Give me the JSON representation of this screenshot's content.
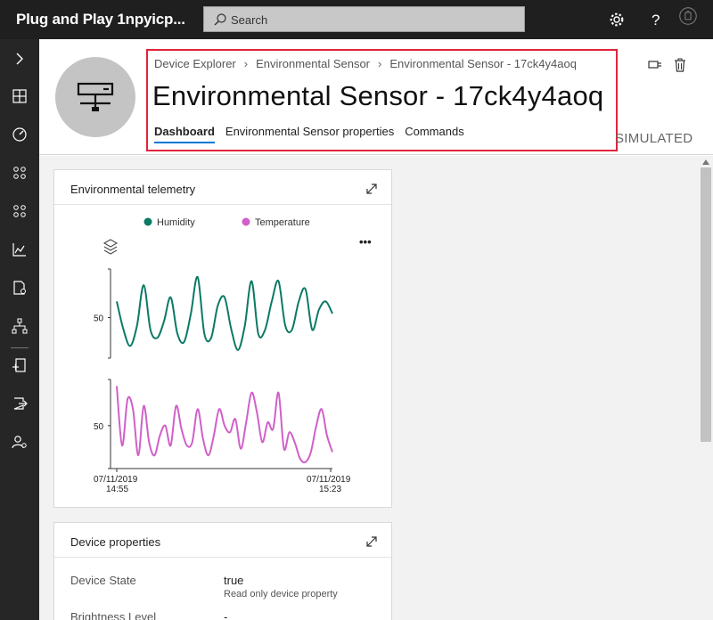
{
  "app": {
    "title": "Plug and Play 1npyicp..."
  },
  "search": {
    "placeholder": "Search"
  },
  "topbar": {
    "settings_icon": "gear-icon",
    "help_icon": "question-icon",
    "account_icon": "account-icon"
  },
  "nav": {
    "items": [
      {
        "icon": "chevron-right-icon"
      },
      {
        "icon": "dashboard-icon"
      },
      {
        "icon": "devices-icon"
      },
      {
        "icon": "device-groups-icon"
      },
      {
        "icon": "rules-icon"
      },
      {
        "icon": "analytics-icon"
      },
      {
        "icon": "jobs-icon"
      },
      {
        "icon": "device-templates-icon"
      },
      {
        "icon": "device-connection-icon"
      },
      {
        "icon": "data-export-icon"
      },
      {
        "icon": "administration-icon"
      }
    ]
  },
  "header": {
    "breadcrumb": [
      "Device Explorer",
      "Environmental Sensor",
      "Environmental Sensor - 17ck4y4aoq"
    ],
    "title": "Environmental Sensor - 17ck4y4aoq",
    "tabs": [
      {
        "label": "Dashboard",
        "active": true
      },
      {
        "label": "Environmental Sensor properties",
        "active": false
      },
      {
        "label": "Commands",
        "active": false
      }
    ],
    "status": "SIMULATED",
    "connect_icon": "connect-icon",
    "delete_icon": "trash-icon"
  },
  "telemetry_card": {
    "title": "Environmental telemetry",
    "more_label": "•••"
  },
  "chart_data": [
    {
      "type": "line",
      "title": "",
      "series": [
        {
          "name": "Humidity",
          "color": "#0b7a64",
          "values": [
            54,
            47,
            43,
            48,
            58,
            47,
            45,
            49,
            55,
            46,
            44,
            51,
            60,
            46,
            45,
            53,
            55,
            47,
            42,
            48,
            59,
            46,
            47,
            54,
            59,
            48,
            47,
            54,
            57,
            47,
            52,
            54,
            51
          ]
        },
        {
          "name": "Temperature",
          "color": "#d060c8",
          "values": [
            62,
            44,
            58,
            55,
            41,
            56,
            45,
            41,
            47,
            50,
            44,
            56,
            49,
            44,
            45,
            55,
            46,
            41,
            47,
            55,
            50,
            48,
            52,
            43,
            51,
            60,
            54,
            45,
            51,
            49,
            60,
            43,
            48,
            45,
            40,
            39,
            42,
            50,
            55,
            47,
            42
          ]
        }
      ],
      "y_tick_label": "50",
      "x_labels": [
        [
          "07/11/2019",
          "14:55"
        ],
        [
          "07/11/2019",
          "15:23"
        ]
      ],
      "legend_position": "top"
    }
  ],
  "properties_card": {
    "title": "Device properties",
    "rows": [
      {
        "label": "Device State",
        "value": "true",
        "note": "Read only device property"
      },
      {
        "label": "Brightness Level",
        "value": "-"
      }
    ]
  }
}
